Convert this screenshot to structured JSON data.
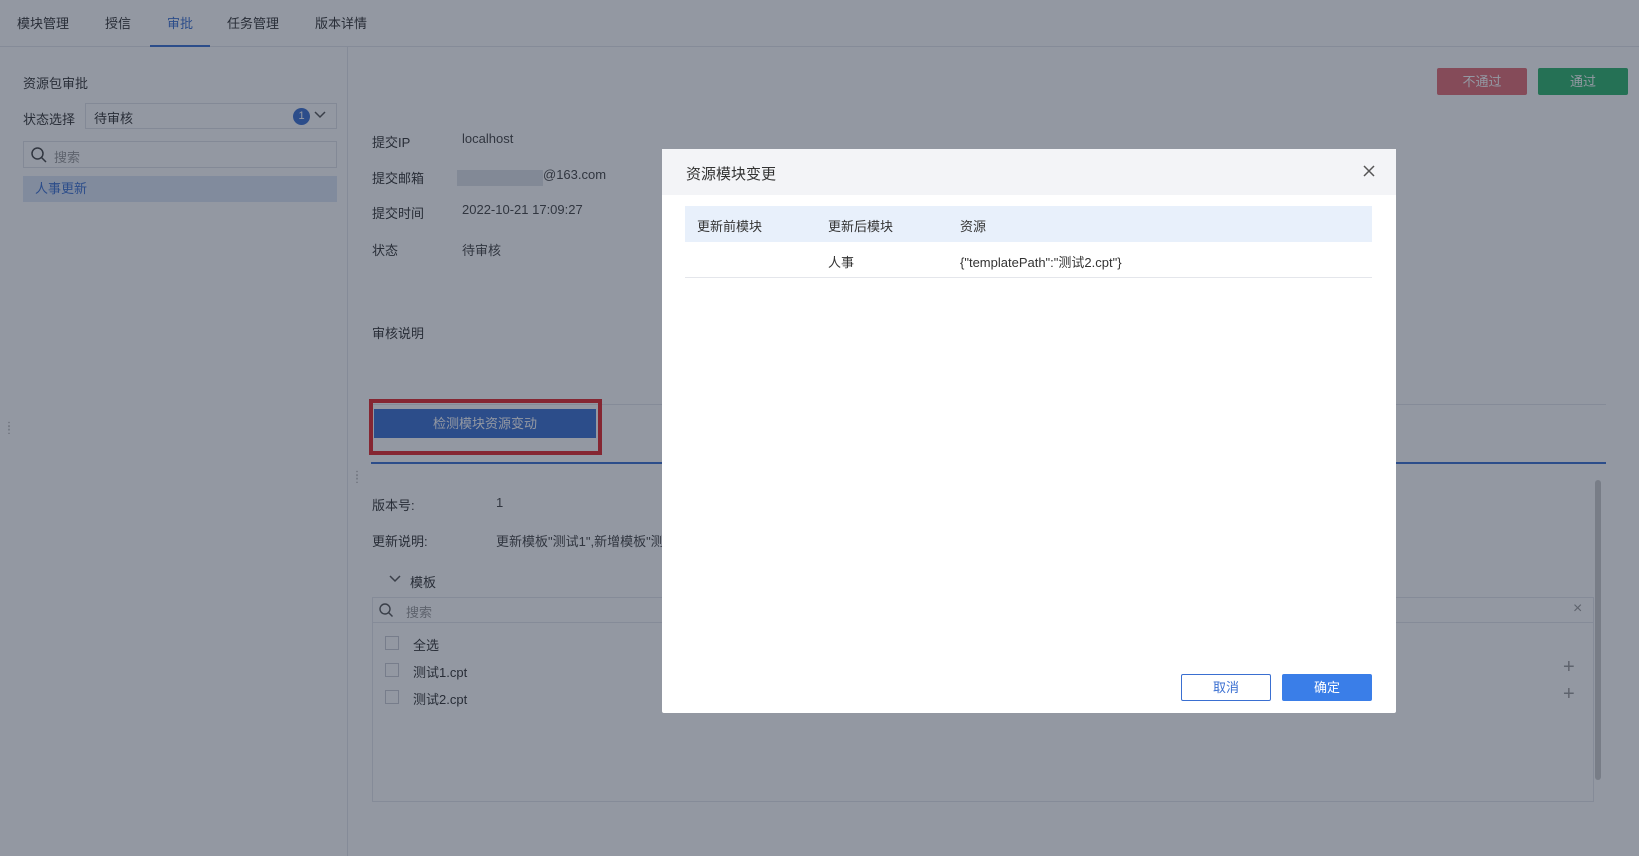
{
  "tabs": [
    {
      "label": "模块管理",
      "active": false
    },
    {
      "label": "授信",
      "active": false
    },
    {
      "label": "审批",
      "active": true
    },
    {
      "label": "任务管理",
      "active": false
    },
    {
      "label": "版本详情",
      "active": false
    }
  ],
  "left": {
    "title": "资源包审批",
    "status_label": "状态选择",
    "status_value": "待审核",
    "status_badge": "1",
    "search_placeholder": "搜索",
    "selected_item": "人事更新"
  },
  "actions": {
    "reject_label": "不通过",
    "pass_label": "通过"
  },
  "detail": {
    "ip_label": "提交IP",
    "ip_value": "localhost",
    "email_label": "提交邮箱",
    "email_value": "@163.com",
    "time_label": "提交时间",
    "time_value": "2022-10-21 17:09:27",
    "state_label": "状态",
    "state_value": "待审核",
    "remark_label": "审核说明",
    "detect_button": "检测模块资源变动",
    "version_label": "版本号:",
    "version_value": "1",
    "desc_label": "更新说明:",
    "desc_value": "更新模板\"测试1\",新增模板\"测"
  },
  "template_tree": {
    "group_label": "模板",
    "search_placeholder": "搜索",
    "items": [
      "全选",
      "测试1.cpt",
      "测试2.cpt"
    ]
  },
  "modal": {
    "title": "资源模块变更",
    "columns": [
      "更新前模块",
      "更新后模块",
      "资源"
    ],
    "rows": [
      [
        "",
        "人事",
        "{\"templatePath\":\"测试2.cpt\"}"
      ]
    ],
    "cancel_label": "取消",
    "ok_label": "确定"
  },
  "colors": {
    "accent": "#3a6fd1",
    "reject": "#e46b73",
    "pass": "#2db56b",
    "highlight_outline": "#e5252a"
  }
}
